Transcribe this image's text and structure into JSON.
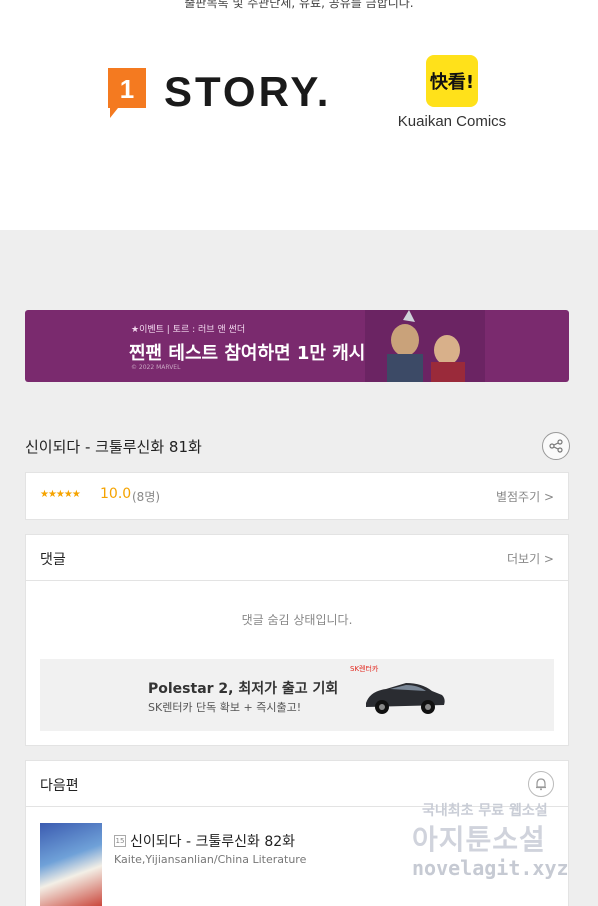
{
  "top": {
    "note": "출판목록 및 주관단체, 유료, 공유를 금합니다.",
    "partner_story": "STORY.",
    "partner_story_badge": "1",
    "partner_kuaikan_badge": "快看!",
    "partner_kuaikan": "Kuaikan Comics"
  },
  "banner": {
    "small": "★이벤트 | 토르 : 러브 앤 썬더",
    "big": "찐팬 테스트 참여하면 1만 캐시!",
    "copyright": "© 2022 MARVEL",
    "bg_color": "#7a2a6e"
  },
  "episode": {
    "title": "신이되다 - 크툴루신화 81화"
  },
  "rating": {
    "stars": "★★★★★",
    "score": "10.0",
    "count": "(8명)",
    "rate_link": "별점주기 >",
    "accent_color": "#f5a300"
  },
  "comments": {
    "title": "댓글",
    "more": "더보기 >",
    "hidden_msg": "댓글 숨김 상태입니다.",
    "ad": {
      "brand": "SK렌터카",
      "title": "Polestar 2, 최저가 출고 기회",
      "subtitle": "SK렌터카 단독 확보 + 즉시출고!"
    }
  },
  "next": {
    "title": "다음편",
    "age_badge": "15",
    "episode_title": "신이되다 - 크툴루신화 82화",
    "author": "Kaite,Yijiansanlian/China Literature"
  },
  "watermark": {
    "line1": "국내최초 무료 웹소설",
    "line2": "아지툰소설",
    "line3": "novelagit.xyz"
  }
}
